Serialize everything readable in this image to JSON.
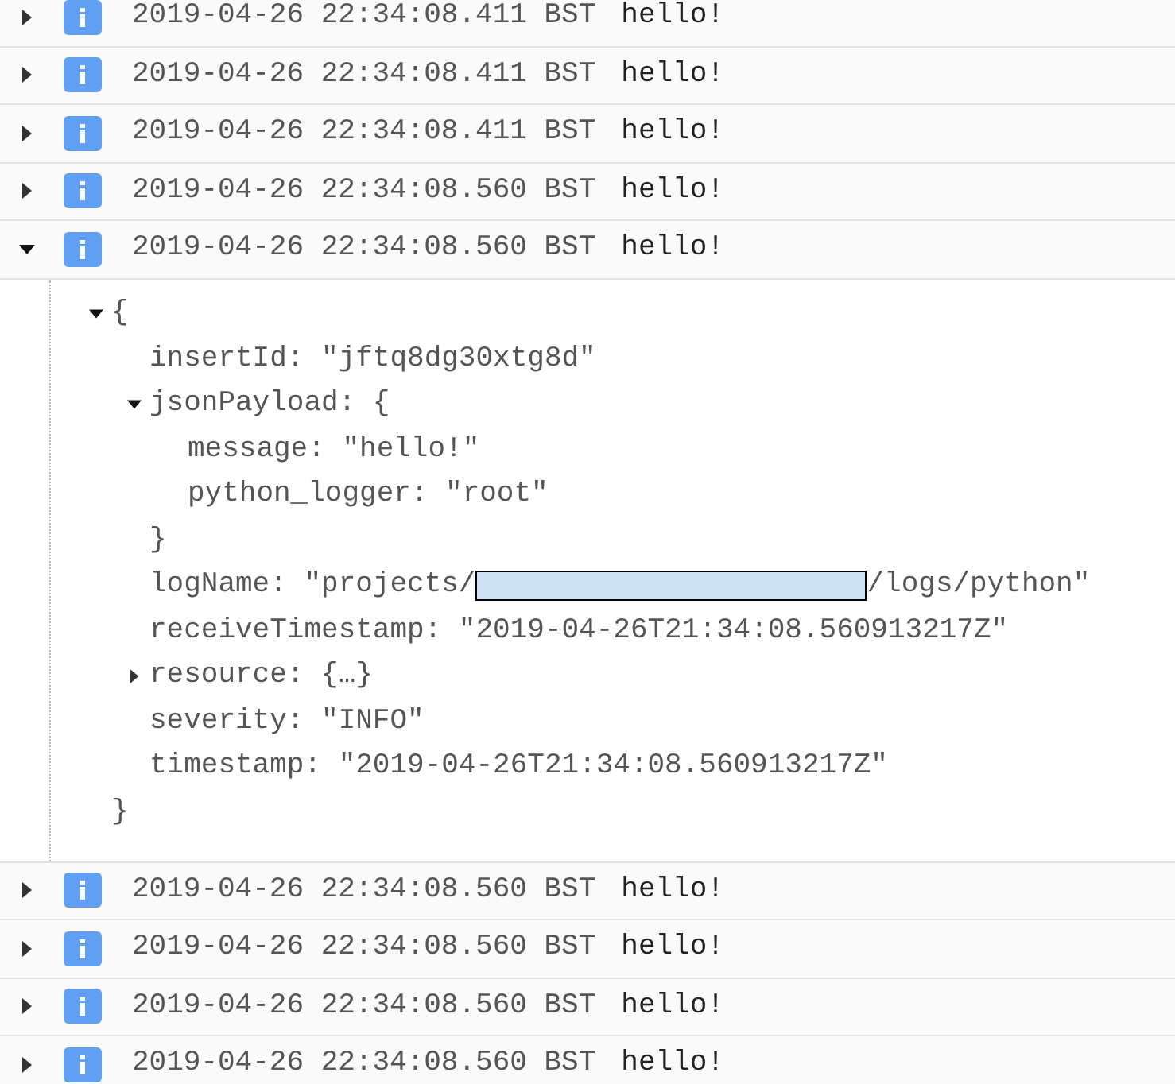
{
  "log_entries": [
    {
      "expanded": false,
      "timestamp": "2019-04-26 22:34:08.411 BST",
      "message": "hello!"
    },
    {
      "expanded": false,
      "timestamp": "2019-04-26 22:34:08.411 BST",
      "message": "hello!"
    },
    {
      "expanded": false,
      "timestamp": "2019-04-26 22:34:08.411 BST",
      "message": "hello!"
    },
    {
      "expanded": false,
      "timestamp": "2019-04-26 22:34:08.560 BST",
      "message": "hello!"
    },
    {
      "expanded": true,
      "timestamp": "2019-04-26 22:34:08.560 BST",
      "message": "hello!",
      "detail": {
        "text": "{",
        "expanded": true,
        "close": "}",
        "children": [
          {
            "text": "insertId: \"jftq8dg30xtg8d\""
          },
          {
            "text": "jsonPayload: {",
            "expanded": true,
            "close": "}",
            "children": [
              {
                "text": "message: \"hello!\""
              },
              {
                "text": "python_logger: \"root\""
              }
            ]
          },
          {
            "text": "logName: \"projects/",
            "redacted": true,
            "text_after": "/logs/python\""
          },
          {
            "text": "receiveTimestamp: \"2019-04-26T21:34:08.560913217Z\""
          },
          {
            "text": "resource: {…}",
            "expanded": false
          },
          {
            "text": "severity: \"INFO\""
          },
          {
            "text": "timestamp: \"2019-04-26T21:34:08.560913217Z\""
          }
        ]
      }
    },
    {
      "expanded": false,
      "timestamp": "2019-04-26 22:34:08.560 BST",
      "message": "hello!"
    },
    {
      "expanded": false,
      "timestamp": "2019-04-26 22:34:08.560 BST",
      "message": "hello!"
    },
    {
      "expanded": false,
      "timestamp": "2019-04-26 22:34:08.560 BST",
      "message": "hello!"
    },
    {
      "expanded": false,
      "timestamp": "2019-04-26 22:34:08.560 BST",
      "message": "hello!"
    }
  ]
}
